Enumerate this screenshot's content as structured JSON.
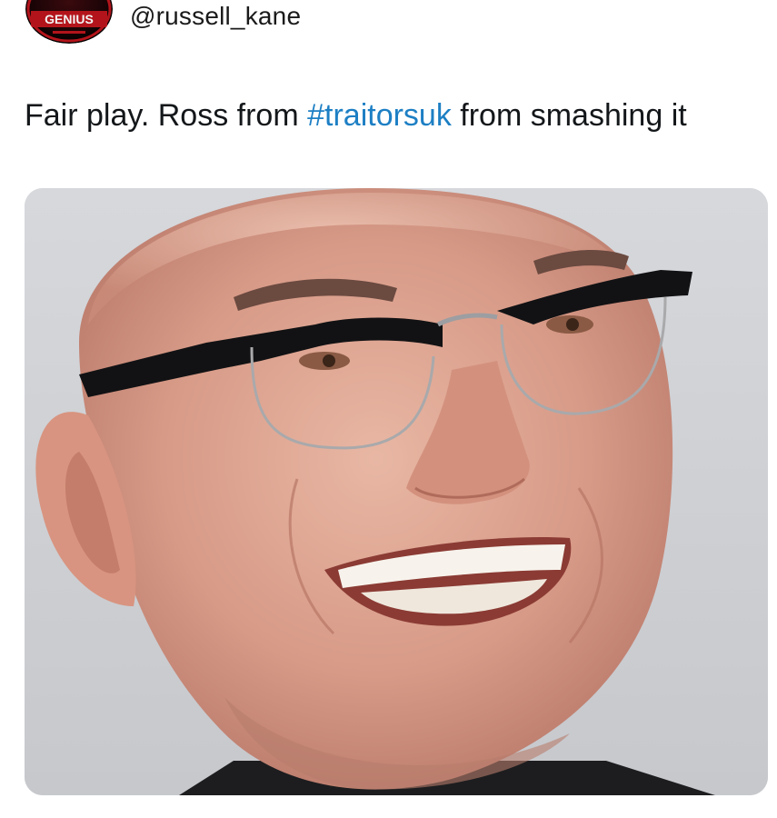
{
  "post": {
    "avatar": {
      "badge_text": "GENIUS",
      "accent_color": "#b3141b"
    },
    "handle": "@russell_kane",
    "text_before": "Fair play. Ross from ",
    "hashtag": "#traitorsuk",
    "text_after": " from smashing it",
    "hashtag_color": "#1d7fc4"
  },
  "media": {
    "background_color": "#cfd1d5"
  }
}
